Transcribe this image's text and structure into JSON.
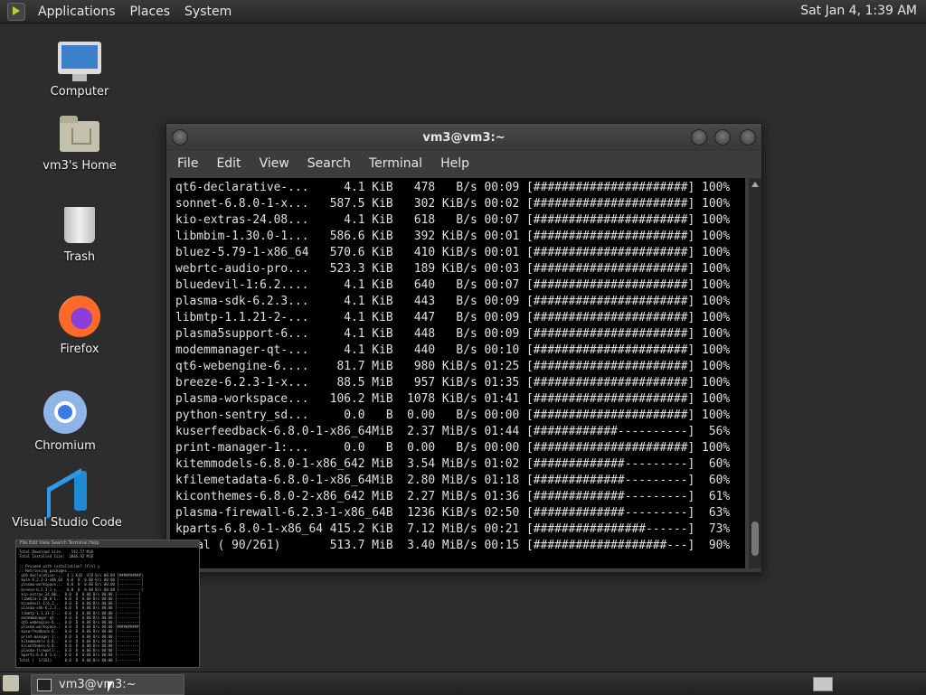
{
  "top_panel": {
    "menus": [
      "Applications",
      "Places",
      "System"
    ],
    "clock": "Sat Jan  4,  1:39 AM"
  },
  "desktop": {
    "icons": [
      {
        "label": "Computer",
        "icon": "monitor-icon"
      },
      {
        "label": "vm3's Home",
        "icon": "home-folder-icon"
      },
      {
        "label": "Trash",
        "icon": "trash-icon"
      },
      {
        "label": "Firefox",
        "icon": "firefox-icon"
      },
      {
        "label": "Chromium",
        "icon": "chromium-icon"
      },
      {
        "label": "Visual Studio Code",
        "icon": "vscode-icon"
      }
    ]
  },
  "terminal": {
    "title": "vm3@vm3:~",
    "menu": [
      "File",
      "Edit",
      "View",
      "Search",
      "Terminal",
      "Help"
    ],
    "lines": [
      "qt6-declarative-...     4.1 KiB   478   B/s 00:09 [######################] 100%",
      "sonnet-6.8.0-1-x...   587.5 KiB   302 KiB/s 00:02 [######################] 100%",
      "kio-extras-24.08...     4.1 KiB   618   B/s 00:07 [######################] 100%",
      "libmbim-1.30.0-1...   586.6 KiB   392 KiB/s 00:01 [######################] 100%",
      "bluez-5.79-1-x86_64   570.6 KiB   410 KiB/s 00:01 [######################] 100%",
      "webrtc-audio-pro...   523.3 KiB   189 KiB/s 00:03 [######################] 100%",
      "bluedevil-1:6.2....     4.1 KiB   640   B/s 00:07 [######################] 100%",
      "plasma-sdk-6.2.3...     4.1 KiB   443   B/s 00:09 [######################] 100%",
      "libmtp-1.1.21-2-...     4.1 KiB   447   B/s 00:09 [######################] 100%",
      "plasma5support-6...     4.1 KiB   448   B/s 00:09 [######################] 100%",
      "modemmanager-qt-...     4.1 KiB   440   B/s 00:10 [######################] 100%",
      "qt6-webengine-6....    81.7 MiB   980 KiB/s 01:25 [######################] 100%",
      "breeze-6.2.3-1-x...    88.5 MiB   957 KiB/s 01:35 [######################] 100%",
      "plasma-workspace...   106.2 MiB  1078 KiB/s 01:41 [######################] 100%",
      "python-sentry_sd...     0.0   B  0.00   B/s 00:00 [######################] 100%",
      "kuserfeedback-6.8.0-1-x86_64MiB  2.37 MiB/s 01:44 [############----------]  56%",
      "print-manager-1:...     0.0   B  0.00   B/s 00:00 [######################] 100%",
      "kitemmodels-6.8.0-1-x86_642 MiB  3.54 MiB/s 01:02 [#############---------]  60%",
      "kfilemetadata-6.8.0-1-x86_64MiB  2.80 MiB/s 01:18 [#############---------]  60%",
      "kiconthemes-6.8.0-2-x86_642 MiB  2.27 MiB/s 01:36 [#############---------]  61%",
      "plasma-firewall-6.2.3-1-x86_64B  1236 KiB/s 02:50 [#############---------]  63%",
      "kparts-6.8.0-1-x86_64 415.2 KiB  7.12 MiB/s 00:21 [################------]  73%",
      "Total ( 90/261)       513.7 MiB  3.40 MiB/s 00:15 [###################---]  90%"
    ]
  },
  "preview": {
    "menu": "File  Edit  View  Search  Terminal  Help",
    "lines": [
      "Total Download Size:    542.57 MiB",
      "Total Installed Size:  2046.92 MiB",
      "",
      ":: Proceed with installation? [Y/n] y",
      ":: Retrieving packages...",
      " qt6-declarative-...  4.1 KiB  478 B/s 00:09 [##########]",
      " kwin-6.2.3-1-x86_64  0.0  B  0.00 B/s 00:00 [----------]",
      " plasma-workspace...  0.0  B  0.00 B/s 00:00 [----------]",
      " breeze-6.2.3-1-x...  0.0  B  0.00 B/s 00:00 [----------]",
      " kio-extras-24.08..  0.0  B  0.00 B/s 00:00 [----------]",
      " libmbim-1.30.0-1..  0.0  B  0.00 B/s 00:00 [----------]",
      " bluedevil-1:6.2...  0.0  B  0.00 B/s 00:00 [----------]",
      " plasma-sdk-6.2.3..  0.0  B  0.00 B/s 00:00 [----------]",
      " libmtp-1.1.21-2-..  0.0  B  0.00 B/s 00:00 [----------]",
      " modemmanager-qt-..  0.0  B  0.00 B/s 00:00 [----------]",
      " qt6-webengine-6...  0.0  B  0.00 B/s 00:00 [----------]",
      " plasma-workspace..  0.0  B  0.00 B/s 00:00 [##########]",
      " kuserfeedback-6..   0.0  B  0.00 B/s 00:00 [----------]",
      " print-manager-1:..  0.0  B  0.00 B/s 00:00 [----------]",
      " kitemmodels-6.8..   0.0  B  0.00 B/s 00:00 [----------]",
      " kiconthemes-6.8..   0.0  B  0.00 B/s 00:00 [----------]",
      " plasma-firewall-..  0.0  B  0.00 B/s 00:00 [----------]",
      " kparts-6.8.0-1-x..  0.0  B  0.00 B/s 00:00 [----------]",
      "Total (  1/261)      0.0  B  0.00 B/s 00:00 [----------]"
    ]
  },
  "bottom_panel": {
    "task_label": "vm3@vm3:~"
  }
}
